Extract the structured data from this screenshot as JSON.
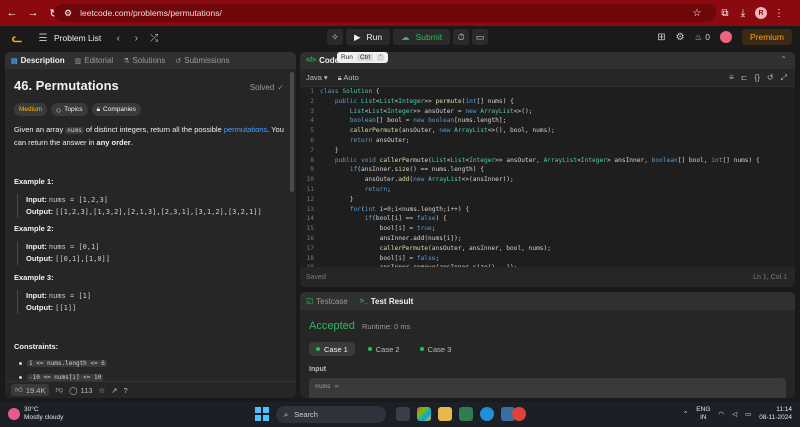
{
  "browser": {
    "url": "leetcode.com/problems/permutations/",
    "avatar_letter": "R"
  },
  "nav": {
    "problem_list": "Problem List",
    "run_label": "Run",
    "submit_label": "Submit",
    "streak_count": "0",
    "premium_label": "Premium"
  },
  "tooltip": {
    "label": "Run",
    "key1": "Ctrl",
    "key2": "'"
  },
  "left_tabs": [
    "Description",
    "Editorial",
    "Solutions",
    "Submissions"
  ],
  "problem": {
    "title": "46. Permutations",
    "status": "Solved",
    "difficulty": "Medium",
    "topics_label": "Topics",
    "companies_label": "Companies",
    "statement_pre": "Given an array ",
    "statement_code": "nums",
    "statement_mid": " of distinct integers, return all the possible ",
    "statement_link": "permutations",
    "statement_post": ". You can return the answer in ",
    "statement_bold": "any order",
    "statement_end": "."
  },
  "examples": [
    {
      "title": "Example 1:",
      "input_label": "Input:",
      "input": "nums = [1,2,3]",
      "output_label": "Output:",
      "output": "[[1,2,3],[1,3,2],[2,1,3],[2,3,1],[3,1,2],[3,2,1]]"
    },
    {
      "title": "Example 2:",
      "input_label": "Input:",
      "input": "nums = [0,1]",
      "output_label": "Output:",
      "output": "[[0,1],[1,0]]"
    },
    {
      "title": "Example 3:",
      "input_label": "Input:",
      "input": "nums = [1]",
      "output_label": "Output:",
      "output": "[[1]]"
    }
  ],
  "constraints": {
    "title": "Constraints:",
    "items": [
      "1 <= nums.length <= 6",
      "-10 <= nums[i] <= 10"
    ]
  },
  "footer": {
    "likes": "19.4K",
    "comments": "113"
  },
  "code": {
    "tab": "Code",
    "language": "Java",
    "mode": "Auto",
    "status": "Saved",
    "position": "Ln 1, Col 1",
    "lines": [
      "class Solution {",
      "    public List<List<Integer>> permute(int[] nums) {",
      "        List<List<Integer>> ansOuter = new ArrayList<>();",
      "        boolean[] bool = new boolean[nums.length];",
      "        callerPermute(ansOuter, new ArrayList<>(), bool, nums);",
      "        return ansOuter;",
      "    }",
      "    public void callerPermute(List<List<Integer>> ansOuter, ArrayList<Integer> ansInner, boolean[] bool, int[] nums) {",
      "        if(ansInner.size() == nums.length) {",
      "            ansOuter.add(new ArrayList<>(ansInner));",
      "            return;",
      "        }",
      "        for(int i=0;i<nums.length;i++) {",
      "            if(bool[i] == false) {",
      "                bool[i] = true;",
      "                ansInner.add(nums[i]);",
      "                callerPermute(ansOuter, ansInner, bool, nums);",
      "                bool[i] = false;",
      "                ansInner.remove(ansInner.size() - 1);"
    ]
  },
  "result": {
    "tab_testcase": "Testcase",
    "tab_result": "Test Result",
    "verdict": "Accepted",
    "runtime": "Runtime: 0 ms",
    "cases": [
      "Case 1",
      "Case 2",
      "Case 3"
    ],
    "input_label": "Input",
    "input_var": "nums ="
  },
  "taskbar": {
    "temp": "30°C",
    "weather": "Mostly cloudy",
    "search": "Search",
    "lang_top": "ENG",
    "lang_bottom": "IN",
    "time": "11:14",
    "date": "08-11-2024"
  }
}
